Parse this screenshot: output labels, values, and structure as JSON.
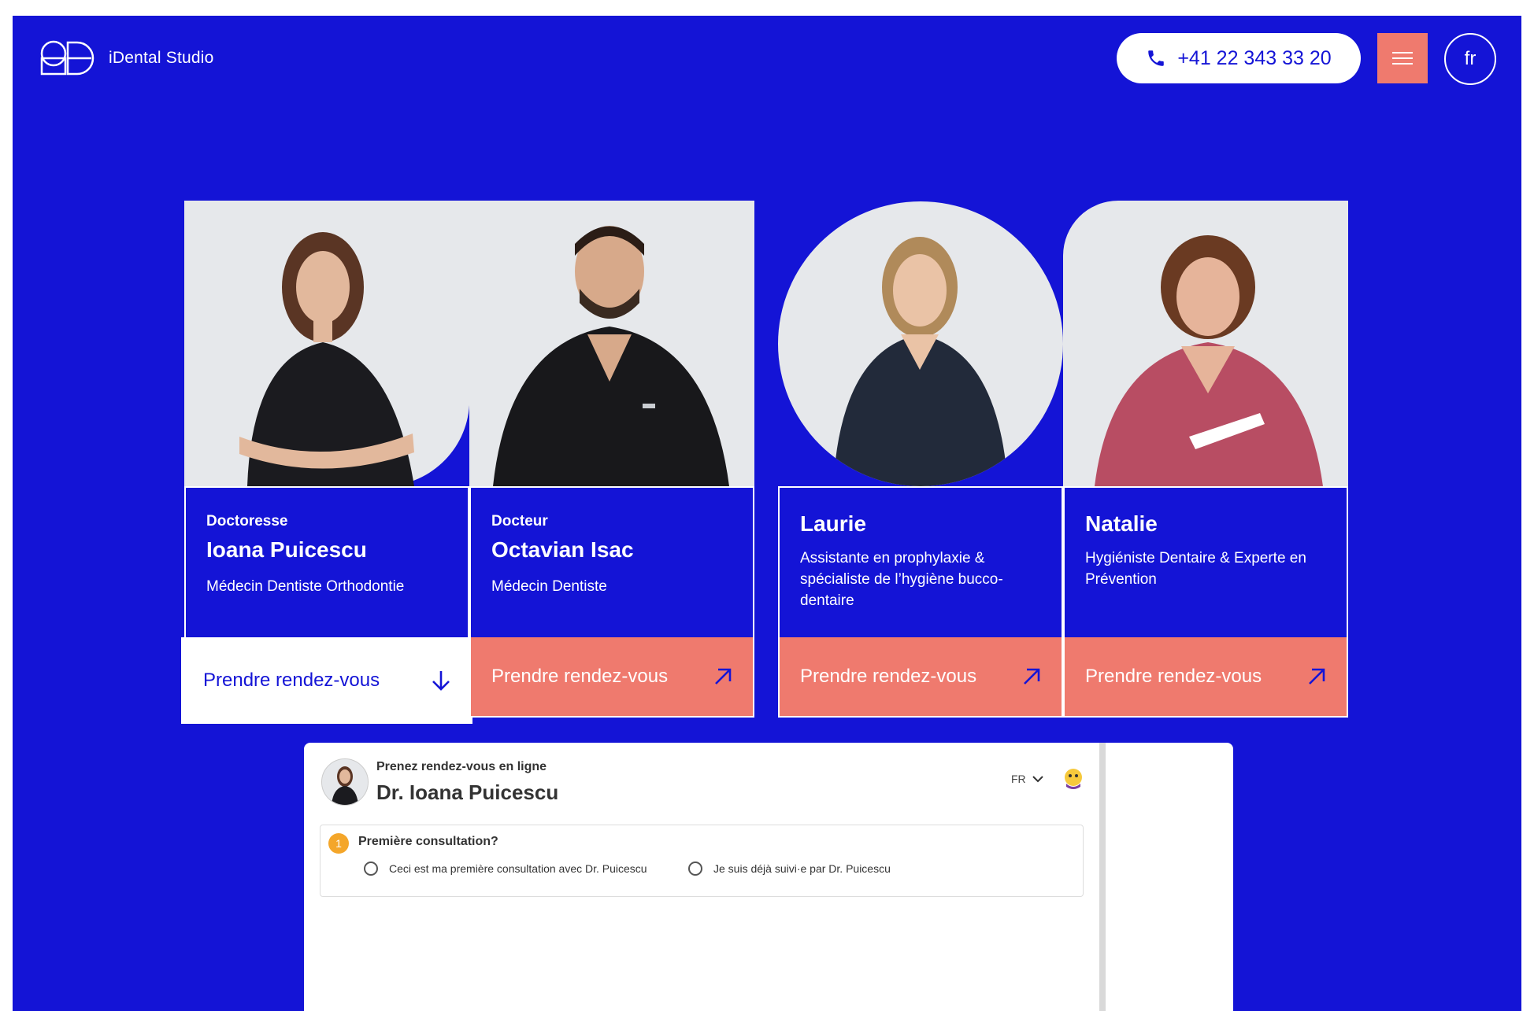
{
  "header": {
    "logo_text": "iDental Studio",
    "phone": "+41 22 343 33 20",
    "lang": "fr"
  },
  "team": [
    {
      "role": "Doctoresse",
      "name": "Ioana Puicescu",
      "specialty": "Médecin Dentiste Orthodontie",
      "cta": "Prendre rendez-vous",
      "cta_icon": "arrow-down-icon"
    },
    {
      "role": "Docteur",
      "name": "Octavian Isac",
      "specialty": "Médecin Dentiste",
      "cta": "Prendre rendez-vous",
      "cta_icon": "arrow-up-right-icon"
    },
    {
      "role": "",
      "name": "Laurie",
      "specialty": "Assistante en prophylaxie & spécialiste de l’hygiène bucco-dentaire",
      "cta": "Prendre rendez-vous",
      "cta_icon": "arrow-up-right-icon"
    },
    {
      "role": "",
      "name": "Natalie",
      "specialty": "Hygiéniste Dentaire & Experte en Prévention",
      "cta": "Prendre rendez-vous",
      "cta_icon": "arrow-up-right-icon"
    }
  ],
  "booking": {
    "subtitle": "Prenez rendez-vous en ligne",
    "doctor": "Dr. Ioana Puicescu",
    "lang": "FR",
    "question_number": "1",
    "question": "Première consultation?",
    "options": [
      "Ceci est ma première consultation avec Dr. Puicescu",
      "Je suis déjà suivi·e par Dr. Puicescu"
    ]
  },
  "colors": {
    "brand_blue": "#1414d6",
    "coral": "#ef7a6e",
    "white": "#ffffff"
  }
}
